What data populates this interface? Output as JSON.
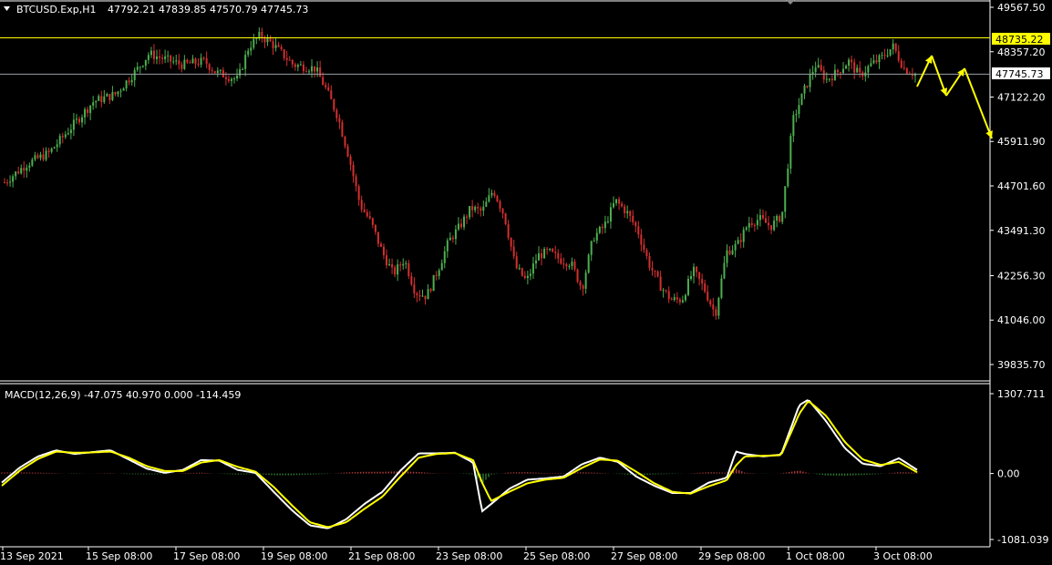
{
  "header": {
    "symbol": "BTCUSD.Exp,H1",
    "ohlc": "47792.21 47839.85 47570.79 47745.73",
    "menu_icon": "triangle-down-icon"
  },
  "macd": {
    "label": "MACD(12,26,9) -47.075 40.970 0.000 -114.459"
  },
  "colors": {
    "background": "#000000",
    "bull_candle": "#4caf50",
    "bear_candle": "#d32f2f",
    "resistance_line": "#ffff00",
    "price_line": "#9aa0a6",
    "arrows": "#ffff00",
    "macd_line": "#ffffff",
    "signal_line": "#ffff00",
    "hist_pos": "#b23b3b",
    "hist_neg": "#2e7d32"
  },
  "chart_data": [
    {
      "type": "candlestick",
      "y_ticks": [
        "49567.50",
        "48357.20",
        "47122.20",
        "45911.90",
        "44701.60",
        "43491.30",
        "42256.30",
        "41046.00",
        "39835.70"
      ],
      "ylim": [
        39835.7,
        49567.5
      ],
      "x_ticks": [
        "13 Sep 2021",
        "15 Sep 08:00",
        "17 Sep 08:00",
        "19 Sep 08:00",
        "21 Sep 08:00",
        "23 Sep 08:00",
        "25 Sep 08:00",
        "27 Sep 08:00",
        "29 Sep 08:00",
        "1 Oct 08:00",
        "3 Oct 08:00"
      ],
      "resistance_level": "48735.22",
      "current_price": "47745.73",
      "close_path": [
        [
          0,
          44800
        ],
        [
          2,
          45300
        ],
        [
          4,
          45600
        ],
        [
          6,
          46300
        ],
        [
          8,
          47000
        ],
        [
          10,
          47200
        ],
        [
          12,
          47900
        ],
        [
          13,
          48300
        ],
        [
          14,
          48200
        ],
        [
          16,
          48000
        ],
        [
          18,
          48100
        ],
        [
          19,
          47800
        ],
        [
          21,
          47600
        ],
        [
          22,
          48500
        ],
        [
          23,
          48800
        ],
        [
          24,
          48600
        ],
        [
          26,
          48000
        ],
        [
          28,
          47900
        ],
        [
          29,
          47300
        ],
        [
          30,
          46600
        ],
        [
          31,
          45500
        ],
        [
          32,
          44200
        ],
        [
          33,
          43700
        ],
        [
          34,
          42900
        ],
        [
          35,
          42300
        ],
        [
          36,
          42700
        ],
        [
          37,
          41800
        ],
        [
          38,
          41700
        ],
        [
          39,
          42400
        ],
        [
          40,
          43200
        ],
        [
          41,
          43600
        ],
        [
          42,
          44100
        ],
        [
          43,
          44000
        ],
        [
          44,
          44600
        ],
        [
          45,
          43900
        ],
        [
          46,
          42500
        ],
        [
          47,
          42100
        ],
        [
          48,
          42800
        ],
        [
          49,
          42900
        ],
        [
          50,
          42700
        ],
        [
          51,
          42600
        ],
        [
          52,
          41900
        ],
        [
          53,
          43300
        ],
        [
          54,
          43600
        ],
        [
          55,
          44300
        ],
        [
          56,
          44000
        ],
        [
          57,
          43500
        ],
        [
          58,
          42600
        ],
        [
          59,
          42000
        ],
        [
          60,
          41600
        ],
        [
          61,
          41600
        ],
        [
          62,
          42400
        ],
        [
          63,
          41900
        ],
        [
          64,
          41200
        ],
        [
          65,
          42900
        ],
        [
          66,
          43100
        ],
        [
          67,
          43700
        ],
        [
          68,
          43800
        ],
        [
          69,
          43600
        ],
        [
          70,
          43900
        ],
        [
          71,
          46500
        ],
        [
          72,
          47300
        ],
        [
          73,
          48000
        ],
        [
          74,
          47600
        ],
        [
          75,
          47800
        ],
        [
          76,
          48100
        ],
        [
          77,
          47700
        ],
        [
          78,
          48000
        ],
        [
          79,
          48200
        ],
        [
          80,
          48500
        ],
        [
          81,
          47900
        ],
        [
          82,
          47745.73
        ]
      ],
      "macd_ticks": [
        "1307.711",
        "0.00",
        "-1081.039"
      ],
      "macd_range": [
        -1081.039,
        1307.711
      ],
      "macd_path": [
        [
          0,
          -150
        ],
        [
          2,
          100
        ],
        [
          4,
          280
        ],
        [
          6,
          380
        ],
        [
          8,
          320
        ],
        [
          10,
          350
        ],
        [
          12,
          380
        ],
        [
          14,
          230
        ],
        [
          16,
          80
        ],
        [
          18,
          10
        ],
        [
          20,
          60
        ],
        [
          22,
          220
        ],
        [
          24,
          210
        ],
        [
          26,
          60
        ],
        [
          28,
          10
        ],
        [
          30,
          -300
        ],
        [
          32,
          -600
        ],
        [
          34,
          -850
        ],
        [
          36,
          -900
        ],
        [
          38,
          -750
        ],
        [
          40,
          -500
        ],
        [
          42,
          -300
        ],
        [
          44,
          50
        ],
        [
          46,
          330
        ],
        [
          48,
          330
        ],
        [
          50,
          340
        ],
        [
          52,
          180
        ],
        [
          53,
          -620
        ],
        [
          54,
          -500
        ],
        [
          56,
          -250
        ],
        [
          58,
          -100
        ],
        [
          60,
          -80
        ],
        [
          62,
          -50
        ],
        [
          64,
          150
        ],
        [
          66,
          260
        ],
        [
          68,
          190
        ],
        [
          70,
          -50
        ],
        [
          72,
          -200
        ],
        [
          74,
          -320
        ],
        [
          76,
          -320
        ],
        [
          78,
          -150
        ],
        [
          80,
          -70
        ],
        [
          81,
          360
        ],
        [
          82,
          320
        ],
        [
          84,
          280
        ],
        [
          86,
          310
        ],
        [
          88,
          1120
        ],
        [
          89,
          1210
        ],
        [
          91,
          850
        ],
        [
          93,
          420
        ],
        [
          95,
          160
        ],
        [
          97,
          120
        ],
        [
          99,
          250
        ],
        [
          101,
          60
        ]
      ],
      "signal_path": [
        [
          0,
          -200
        ],
        [
          2,
          50
        ],
        [
          4,
          240
        ],
        [
          6,
          360
        ],
        [
          8,
          340
        ],
        [
          10,
          345
        ],
        [
          12,
          360
        ],
        [
          14,
          260
        ],
        [
          16,
          120
        ],
        [
          18,
          40
        ],
        [
          20,
          40
        ],
        [
          22,
          180
        ],
        [
          24,
          220
        ],
        [
          26,
          110
        ],
        [
          28,
          30
        ],
        [
          30,
          -220
        ],
        [
          32,
          -520
        ],
        [
          34,
          -800
        ],
        [
          36,
          -880
        ],
        [
          38,
          -800
        ],
        [
          40,
          -580
        ],
        [
          42,
          -380
        ],
        [
          44,
          -50
        ],
        [
          46,
          260
        ],
        [
          48,
          320
        ],
        [
          50,
          335
        ],
        [
          52,
          220
        ],
        [
          53,
          -150
        ],
        [
          54,
          -450
        ],
        [
          56,
          -300
        ],
        [
          58,
          -160
        ],
        [
          60,
          -100
        ],
        [
          62,
          -70
        ],
        [
          64,
          90
        ],
        [
          66,
          230
        ],
        [
          68,
          210
        ],
        [
          70,
          30
        ],
        [
          72,
          -160
        ],
        [
          74,
          -300
        ],
        [
          76,
          -330
        ],
        [
          78,
          -210
        ],
        [
          80,
          -110
        ],
        [
          81,
          130
        ],
        [
          82,
          280
        ],
        [
          84,
          290
        ],
        [
          86,
          300
        ],
        [
          88,
          980
        ],
        [
          89,
          1190
        ],
        [
          91,
          940
        ],
        [
          93,
          520
        ],
        [
          95,
          230
        ],
        [
          97,
          140
        ],
        [
          99,
          190
        ],
        [
          101,
          20
        ]
      ]
    }
  ]
}
